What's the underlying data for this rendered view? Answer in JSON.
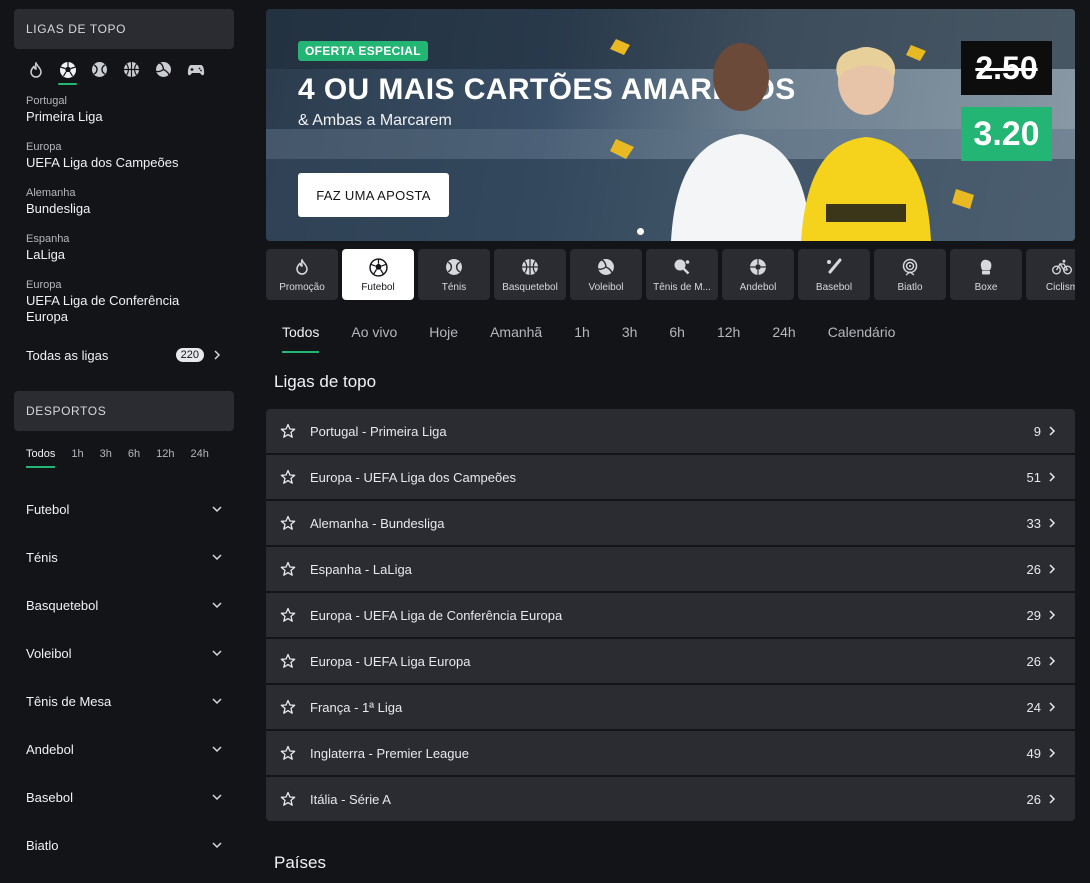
{
  "sidebar": {
    "top_leagues_header": "LIGAS DE TOPO",
    "sport_icons": [
      "flame-icon",
      "football-icon",
      "tennis-icon",
      "basketball-icon",
      "volleyball-icon",
      "gamepad-icon"
    ],
    "leagues": [
      {
        "region": "Portugal",
        "name": "Primeira Liga"
      },
      {
        "region": "Europa",
        "name": "UEFA Liga dos Campeões"
      },
      {
        "region": "Alemanha",
        "name": "Bundesliga"
      },
      {
        "region": "Espanha",
        "name": "LaLiga"
      },
      {
        "region": "Europa",
        "name": "UEFA Liga de Conferência Europa"
      }
    ],
    "all_leagues_label": "Todas as ligas",
    "all_leagues_count": "220",
    "sports_header": "DESPORTOS",
    "time_filters": [
      "Todos",
      "1h",
      "3h",
      "6h",
      "12h",
      "24h"
    ],
    "sports": [
      "Futebol",
      "Ténis",
      "Basquetebol",
      "Voleibol",
      "Tênis de Mesa",
      "Andebol",
      "Basebol",
      "Biatlo"
    ]
  },
  "banner": {
    "offer_badge": "OFERTA ESPECIAL",
    "headline": "4 OU MAIS CARTÕES AMARELOS",
    "subline": "& Ambas a Marcarem",
    "cta": "FAZ UMA APOSTA",
    "old_odds": "2.50",
    "new_odds": "3.20",
    "accent_color": "#22b573"
  },
  "sport_tabs": [
    {
      "label": "Promoção",
      "icon": "flame-icon"
    },
    {
      "label": "Futebol",
      "icon": "football-icon",
      "active": true
    },
    {
      "label": "Ténis",
      "icon": "tennis-icon"
    },
    {
      "label": "Basquetebol",
      "icon": "basketball-icon"
    },
    {
      "label": "Voleibol",
      "icon": "volleyball-icon"
    },
    {
      "label": "Tênis de M...",
      "icon": "table-tennis-icon"
    },
    {
      "label": "Andebol",
      "icon": "handball-icon"
    },
    {
      "label": "Basebol",
      "icon": "baseball-icon"
    },
    {
      "label": "Biatlo",
      "icon": "target-icon"
    },
    {
      "label": "Boxe",
      "icon": "boxing-glove-icon"
    },
    {
      "label": "Ciclism",
      "icon": "bicycle-icon"
    }
  ],
  "main": {
    "filter_tabs": [
      "Todos",
      "Ao vivo",
      "Hoje",
      "Amanhã",
      "1h",
      "3h",
      "6h",
      "12h",
      "24h",
      "Calendário"
    ],
    "top_leagues_title": "Ligas de topo",
    "top_leagues": [
      {
        "name": "Portugal - Primeira Liga",
        "count": "9"
      },
      {
        "name": "Europa - UEFA Liga dos Campeões",
        "count": "51"
      },
      {
        "name": "Alemanha - Bundesliga",
        "count": "33"
      },
      {
        "name": "Espanha - LaLiga",
        "count": "26"
      },
      {
        "name": "Europa - UEFA Liga de Conferência Europa",
        "count": "29"
      },
      {
        "name": "Europa - UEFA Liga Europa",
        "count": "26"
      },
      {
        "name": "França - 1ª Liga",
        "count": "24"
      },
      {
        "name": "Inglaterra - Premier League",
        "count": "49"
      },
      {
        "name": "Itália - Série A",
        "count": "26"
      }
    ],
    "countries_title": "Países"
  }
}
